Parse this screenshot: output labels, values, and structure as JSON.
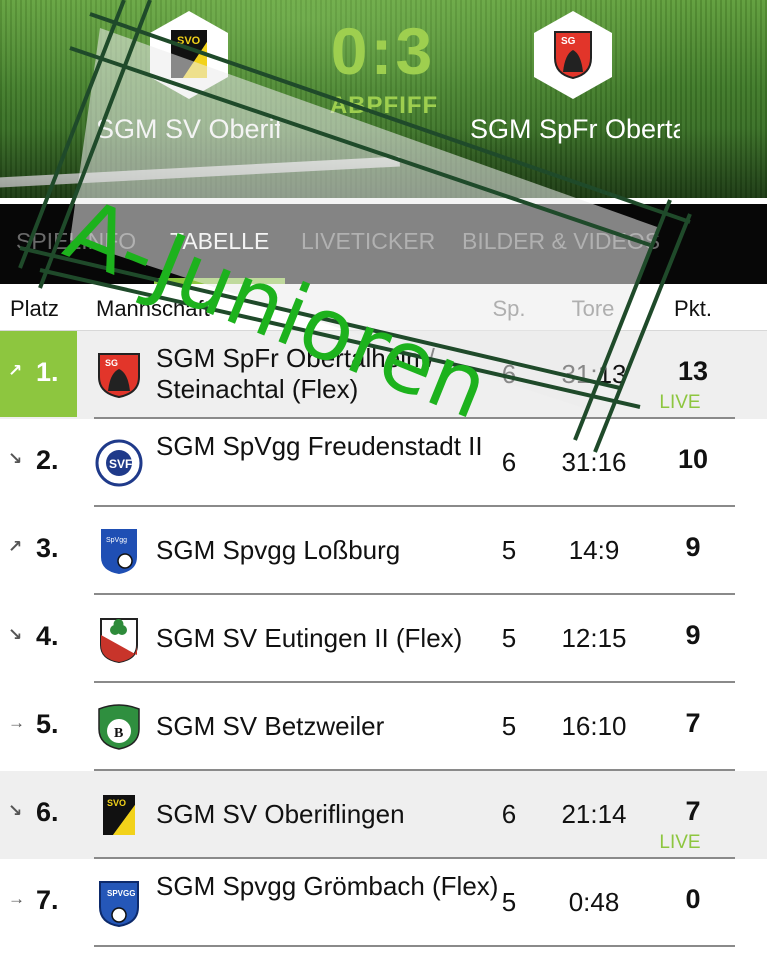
{
  "match": {
    "score": "0:3",
    "state": "ABPFIFF",
    "home_team": "SGM SV Oberiflingen",
    "away_team": "SGM SpFr Obertalheim/S..."
  },
  "tabs": [
    {
      "label": "SPIELINFO",
      "active": false
    },
    {
      "label": "TABELLE",
      "active": true
    },
    {
      "label": "LIVETICKER",
      "active": false
    },
    {
      "label": "BILDER & VIDEOS",
      "active": false
    }
  ],
  "table": {
    "headers": {
      "platz": "Platz",
      "team": "Mannschaft",
      "sp": "Sp.",
      "tore": "Tore",
      "pkt": "Pkt."
    },
    "rows": [
      {
        "trend": "↗",
        "rank": "1.",
        "team": "SGM SpFr Obertalheim/ Steinachtal (Flex)",
        "sp": "6",
        "goals": "31:13",
        "pts": "13",
        "live": "LIVE",
        "logo": "tailheim-crest-icon"
      },
      {
        "trend": "↘",
        "rank": "2.",
        "team": "SGM SpVgg Freudenstadt II",
        "sp": "6",
        "goals": "31:16",
        "pts": "10",
        "live": "",
        "logo": "freudenstadt-crest-icon"
      },
      {
        "trend": "↗",
        "rank": "3.",
        "team": "SGM Spvgg Loßburg",
        "sp": "5",
        "goals": "14:9",
        "pts": "9",
        "live": "",
        "logo": "lossburg-crest-icon"
      },
      {
        "trend": "↘",
        "rank": "4.",
        "team": "SGM SV Eutingen II (Flex)",
        "sp": "5",
        "goals": "12:15",
        "pts": "9",
        "live": "",
        "logo": "eutingen-crest-icon"
      },
      {
        "trend": "→",
        "rank": "5.",
        "team": "SGM SV Betzweiler",
        "sp": "5",
        "goals": "16:10",
        "pts": "7",
        "live": "",
        "logo": "betzweiler-crest-icon"
      },
      {
        "trend": "↘",
        "rank": "6.",
        "team": "SGM SV Oberiflingen",
        "sp": "6",
        "goals": "21:14",
        "pts": "7",
        "live": "LIVE",
        "logo": "oberiflingen-crest-icon"
      },
      {
        "trend": "→",
        "rank": "7.",
        "team": "SGM Spvgg Grömbach (Flex)",
        "sp": "5",
        "goals": "0:48",
        "pts": "0",
        "live": "",
        "logo": "groembach-crest-icon"
      }
    ]
  },
  "overlay": {
    "text": "A-Junioren"
  },
  "colors": {
    "accent": "#8dc63f",
    "stamp": "#1db21d",
    "stamp_frame": "#1f4a2a"
  }
}
